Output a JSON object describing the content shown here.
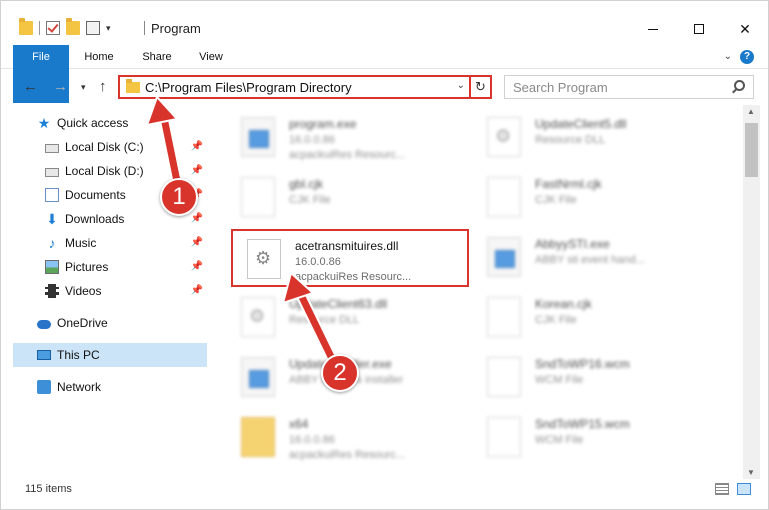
{
  "window": {
    "title": "Program",
    "controls": [
      "minimize",
      "maximize",
      "close"
    ]
  },
  "ribbon": {
    "tabs": [
      "File",
      "Home",
      "Share",
      "View"
    ],
    "help": "?"
  },
  "address_bar": {
    "path": "C:\\Program Files\\Program Directory",
    "refresh_icon": "refresh-icon"
  },
  "search": {
    "placeholder": "Search Program"
  },
  "sidebar": {
    "items": [
      {
        "label": "Quick access",
        "icon": "star-icon"
      },
      {
        "label": "Local Disk (C:)",
        "icon": "disk-icon",
        "pinned": true
      },
      {
        "label": "Local Disk (D:)",
        "icon": "disk-icon",
        "pinned": true
      },
      {
        "label": "Documents",
        "icon": "documents-icon",
        "pinned": true
      },
      {
        "label": "Downloads",
        "icon": "downloads-icon",
        "pinned": true
      },
      {
        "label": "Music",
        "icon": "music-icon",
        "pinned": true
      },
      {
        "label": "Pictures",
        "icon": "pictures-icon",
        "pinned": true
      },
      {
        "label": "Videos",
        "icon": "videos-icon",
        "pinned": true
      },
      {
        "label": "OneDrive",
        "icon": "onedrive-icon"
      },
      {
        "label": "This PC",
        "icon": "this-pc-icon",
        "selected": true
      },
      {
        "label": "Network",
        "icon": "network-icon"
      }
    ]
  },
  "files": [
    {
      "name": "program.exe",
      "meta1": "16.0.0.86",
      "meta2": "acpackuiRes Resourc...",
      "kind": "exe",
      "blurred": true
    },
    {
      "name": "UpdateClient5.dll",
      "meta1": "Resource DLL",
      "meta2": "",
      "kind": "dll",
      "blurred": true
    },
    {
      "name": "gbl.cjk",
      "meta1": "CJK File",
      "meta2": "",
      "kind": "file",
      "blurred": true
    },
    {
      "name": "FastNrml.cjk",
      "meta1": "CJK File",
      "meta2": "",
      "kind": "file",
      "blurred": true
    },
    {
      "name": "acetransmituires.dll",
      "meta1": "16.0.0.86",
      "meta2": "acpackuiRes Resourc...",
      "kind": "dll",
      "blurred": false,
      "highlighted": true
    },
    {
      "name": "AbbyySTI.exe",
      "meta1": "ABBY sti event hand...",
      "meta2": "",
      "kind": "exe",
      "blurred": true
    },
    {
      "name": "UpdateClient63.dll",
      "meta1": "Resource DLL",
      "meta2": "",
      "kind": "dll",
      "blurred": true
    },
    {
      "name": "Korean.cjk",
      "meta1": "CJK File",
      "meta2": "",
      "kind": "file",
      "blurred": true
    },
    {
      "name": "UpdateInstaller.exe",
      "meta1": "ABBY Updates installer",
      "meta2": "",
      "kind": "exe",
      "blurred": true
    },
    {
      "name": "SndToWP16.wcm",
      "meta1": "WCM File",
      "meta2": "",
      "kind": "file",
      "blurred": true
    },
    {
      "name": "x64",
      "meta1": "16.0.0.86",
      "meta2": "acpackuiRes Resourc...",
      "kind": "folder",
      "blurred": true
    },
    {
      "name": "SndToWP15.wcm",
      "meta1": "WCM File",
      "meta2": "",
      "kind": "file",
      "blurred": true
    }
  ],
  "status_bar": {
    "item_count": "115 items"
  },
  "annotations": [
    {
      "label": "1"
    },
    {
      "label": "2"
    }
  ],
  "colors": {
    "accent": "#1979ca",
    "highlight_red": "#d9342b",
    "selected_bg": "#cce4f7"
  }
}
